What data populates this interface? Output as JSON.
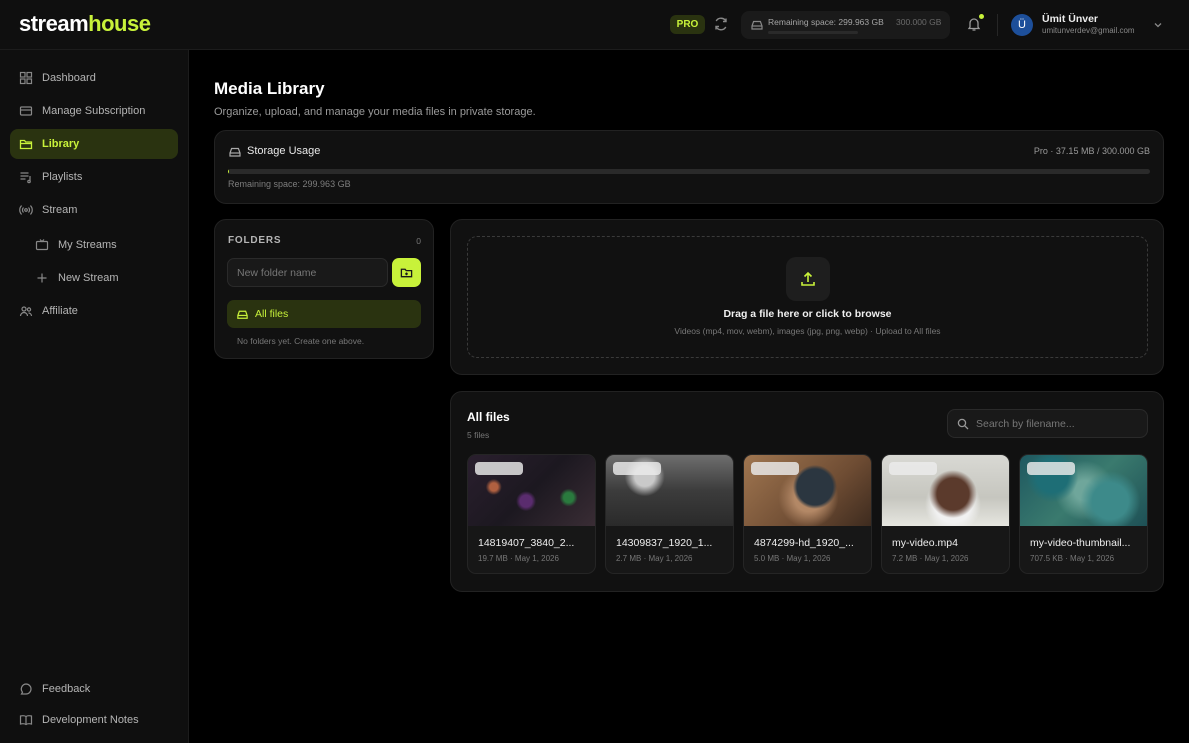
{
  "app": {
    "logo_part1": "stream",
    "logo_part2": "house",
    "accent_color": "#c8f23a"
  },
  "header": {
    "plan_badge": "PRO",
    "storage_remaining": "Remaining space: 299.963 GB",
    "storage_total": "300.000 GB",
    "notification_dot": true,
    "user": {
      "initial": "Ü",
      "name": "Ümit Ünver",
      "email": "umitunverdev@gmail.com"
    }
  },
  "sidebar": {
    "items": [
      {
        "label": "Dashboard",
        "icon": "grid-icon"
      },
      {
        "label": "Manage Subscription",
        "icon": "card-icon"
      },
      {
        "label": "Library",
        "icon": "folder-icon",
        "active": true
      },
      {
        "label": "Playlists",
        "icon": "playlist-icon"
      },
      {
        "label": "Stream",
        "icon": "broadcast-icon"
      },
      {
        "label": "My Streams",
        "icon": "tv-icon",
        "sub": true
      },
      {
        "label": "New Stream",
        "icon": "plus-icon",
        "sub": true
      },
      {
        "label": "Affiliate",
        "icon": "users-icon"
      }
    ],
    "footer": [
      {
        "label": "Feedback",
        "icon": "chat-icon"
      },
      {
        "label": "Development Notes",
        "icon": "book-icon"
      }
    ]
  },
  "main": {
    "title": "Media Library",
    "subtitle": "Organize, upload, and manage your media files in private storage.",
    "storage": {
      "title": "Storage Usage",
      "summary": "Pro · 37.15 MB / 300.000 GB",
      "remaining": "Remaining space: 299.963 GB",
      "used_fraction": 0.0001
    },
    "folders": {
      "title": "FOLDERS",
      "count": "0",
      "input_placeholder": "New folder name",
      "input_value": "",
      "all_files_label": "All files",
      "empty_text": "No folders yet. Create one above."
    },
    "upload": {
      "title": "Drag a file here or click to browse",
      "subtitle": "Videos (mp4, mov, webm), images (jpg, png, webp) · Upload to All files"
    },
    "files": {
      "title": "All files",
      "count": "5 files",
      "search_placeholder": "Search by filename...",
      "items": [
        {
          "name": "14819407_3840_2...",
          "meta": "19.7 MB · May 1, 2026"
        },
        {
          "name": "14309837_1920_1...",
          "meta": "2.7 MB · May 1, 2026"
        },
        {
          "name": "4874299-hd_1920_...",
          "meta": "5.0 MB · May 1, 2026"
        },
        {
          "name": "my-video.mp4",
          "meta": "7.2 MB · May 1, 2026"
        },
        {
          "name": "my-video-thumbnail...",
          "meta": "707.5 KB · May 1, 2026"
        }
      ]
    }
  }
}
